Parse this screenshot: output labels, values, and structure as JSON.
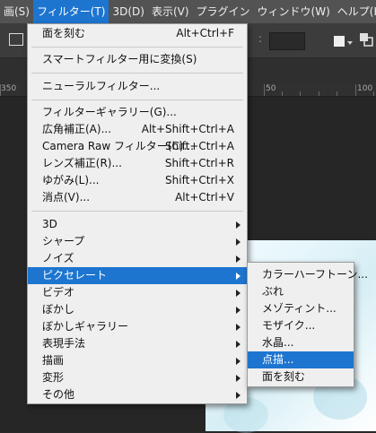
{
  "menubar": {
    "items": [
      {
        "label": "画(S)"
      },
      {
        "label": "フィルター(T)",
        "active": true
      },
      {
        "label": "3D(D)"
      },
      {
        "label": "表示(V)"
      },
      {
        "label": "プラグイン"
      },
      {
        "label": "ウィンドウ(W)"
      },
      {
        "label": "ヘルプ(H)"
      }
    ]
  },
  "ruler": {
    "labels": [
      "350",
      "50",
      "100"
    ]
  },
  "filter_menu": {
    "items": [
      {
        "label": "面を刻む",
        "shortcut": "Alt+Ctrl+F"
      },
      {
        "label": "スマートフィルター用に変換(S)",
        "shortcut": ""
      },
      {
        "label": "ニューラルフィルター...",
        "shortcut": ""
      },
      {
        "label": "フィルターギャラリー(G)...",
        "shortcut": ""
      },
      {
        "label": "広角補正(A)...",
        "shortcut": "Alt+Shift+Ctrl+A"
      },
      {
        "label": "Camera Raw フィルター(C)...",
        "shortcut": "Shift+Ctrl+A"
      },
      {
        "label": "レンズ補正(R)...",
        "shortcut": "Shift+Ctrl+R"
      },
      {
        "label": "ゆがみ(L)...",
        "shortcut": "Shift+Ctrl+X"
      },
      {
        "label": "消点(V)...",
        "shortcut": "Alt+Ctrl+V"
      },
      {
        "label": "3D",
        "submenu": true
      },
      {
        "label": "シャープ",
        "submenu": true
      },
      {
        "label": "ノイズ",
        "submenu": true
      },
      {
        "label": "ピクセレート",
        "submenu": true,
        "highlighted": true
      },
      {
        "label": "ビデオ",
        "submenu": true
      },
      {
        "label": "ぼかし",
        "submenu": true
      },
      {
        "label": "ぼかしギャラリー",
        "submenu": true
      },
      {
        "label": "表現手法",
        "submenu": true
      },
      {
        "label": "描画",
        "submenu": true
      },
      {
        "label": "変形",
        "submenu": true
      },
      {
        "label": "その他",
        "submenu": true
      }
    ]
  },
  "pixelate_submenu": {
    "items": [
      {
        "label": "カラーハーフトーン..."
      },
      {
        "label": "ぶれ"
      },
      {
        "label": "メゾティント..."
      },
      {
        "label": "モザイク..."
      },
      {
        "label": "水晶..."
      },
      {
        "label": "点描...",
        "highlighted": true
      },
      {
        "label": "面を刻む"
      }
    ]
  },
  "colors": {
    "menubar_bg": "#535353",
    "highlight": "#1d75d0",
    "menu_bg": "#efefef"
  }
}
